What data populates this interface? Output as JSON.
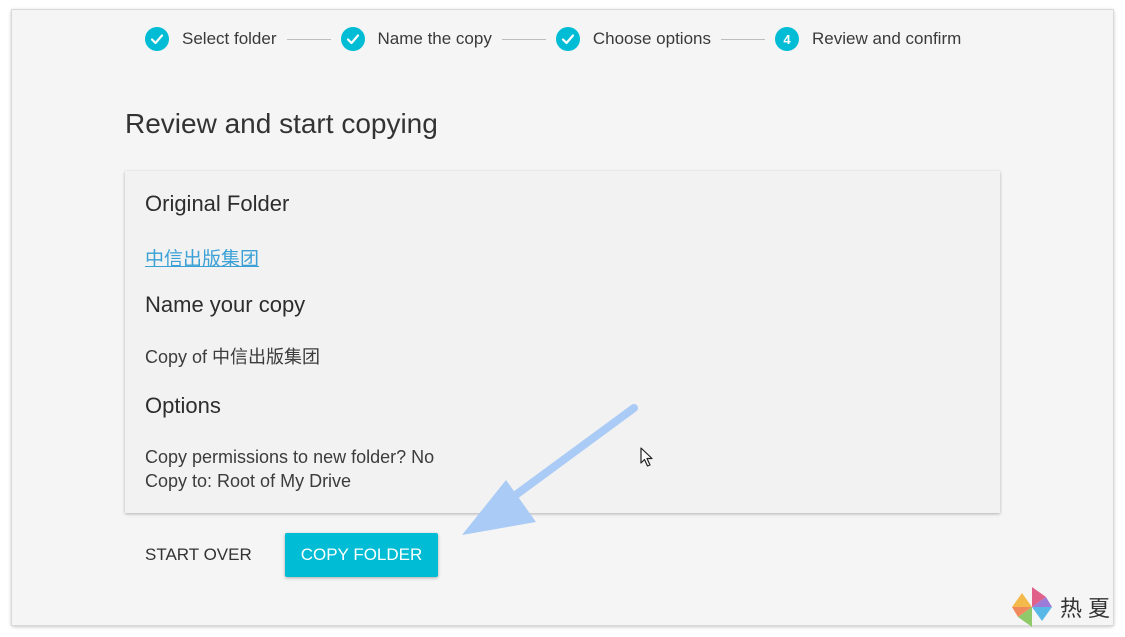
{
  "stepper": {
    "steps": [
      {
        "label": "Select folder",
        "state": "complete",
        "icon": "check-icon"
      },
      {
        "label": "Name the copy",
        "state": "complete",
        "icon": "check-icon"
      },
      {
        "label": "Choose options",
        "state": "complete",
        "icon": "check-icon"
      },
      {
        "label": "Review and confirm",
        "state": "active",
        "number": "4"
      }
    ]
  },
  "page": {
    "title": "Review and start copying"
  },
  "review": {
    "original_heading": "Original Folder",
    "original_link": "中信出版集团",
    "name_heading": "Name your copy",
    "name_value": "Copy of 中信出版集团",
    "options_heading": "Options",
    "options_permissions": "Copy permissions to new folder? No",
    "options_destination": "Copy to: Root of My Drive"
  },
  "actions": {
    "start_over": "START OVER",
    "copy_folder": "COPY FOLDER"
  },
  "watermark": {
    "text": "热夏"
  },
  "colors": {
    "accent": "#00bcd4",
    "link": "#3aa0d6",
    "annotation_arrow": "#a9cbf5"
  }
}
